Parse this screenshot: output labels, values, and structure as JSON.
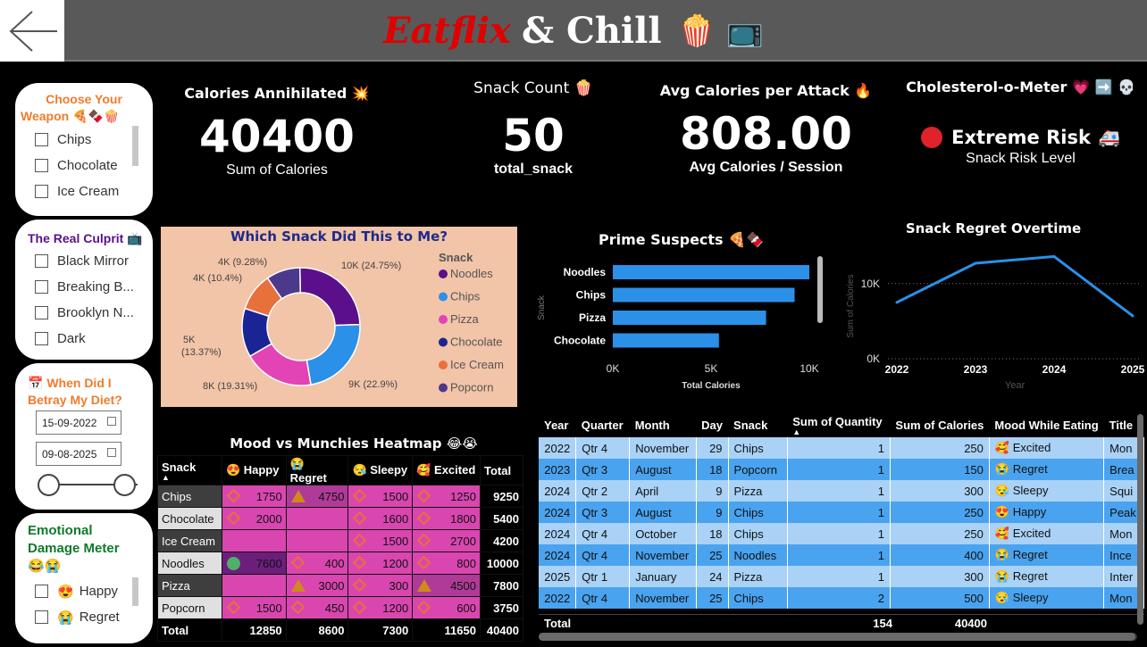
{
  "header": {
    "title_part1": "Eatflix",
    "title_part2": "& Chill",
    "title_emoji": "🍿 📺"
  },
  "slicers": {
    "weapon": {
      "title_line1": "Choose Your",
      "title_line2": "Weapon 🍕🍫🍿",
      "items": [
        "Chips",
        "Chocolate",
        "Ice Cream"
      ]
    },
    "culprit": {
      "title": "The Real Culprit 📺",
      "items": [
        "Black Mirror",
        "Breaking B...",
        "Brooklyn N...",
        "Dark"
      ]
    },
    "date": {
      "title_line1": "📅 When Did I",
      "title_line2": "Betray My Diet?",
      "start": "15-09-2022",
      "end": "09-08-2025",
      "range_fraction": [
        0,
        1
      ]
    },
    "damage": {
      "title_line1": "Emotional",
      "title_line2": "Damage Meter",
      "title_emoji": "😂😭",
      "items": [
        {
          "emoji": "😍",
          "label": "Happy"
        },
        {
          "emoji": "😭",
          "label": "Regret"
        }
      ]
    }
  },
  "kpis": {
    "calories": {
      "title": "Calories Annihilated 💥",
      "value": "40400",
      "sub": "Sum of Calories"
    },
    "count": {
      "title": "Snack Count 🍿",
      "value": "50",
      "sub": "total_snack"
    },
    "avg": {
      "title": "Avg Calories per Attack 🔥",
      "value": "808.00",
      "sub": "Avg Calories / Session"
    },
    "risk": {
      "title": "Cholesterol-o-Meter 💗 ➡️ 💀",
      "value": "Extreme Risk",
      "emoji": "🚑",
      "sub": "Snack Risk Level",
      "dot_color": "#e0222b"
    }
  },
  "donut": {
    "title": "Which Snack Did This to Me?",
    "legend_title": "Snack",
    "background": "#f2c4a8",
    "title_color": "#1f2a8a"
  },
  "bar": {
    "title": "Prime Suspects 🍕🍫",
    "ylabel": "Snack",
    "xlabel": "Total Calories"
  },
  "line": {
    "title": "Snack Regret Overtime",
    "xlabel": "Year",
    "ylabel": "Sum of Calories"
  },
  "heatmap": {
    "title": "Mood vs Munchies Heatmap 😂😭",
    "columns": [
      "Snack",
      "😍 Happy",
      "😭 Regret",
      "😪 Sleepy",
      "🥰 Excited",
      "Total"
    ],
    "rows": [
      {
        "snack": "Chips",
        "happy": "1750",
        "regret": "4750",
        "sleepy": "1500",
        "excited": "1250",
        "total": "9250",
        "icons": [
          "diamond",
          "triangle",
          "diamond",
          "diamond"
        ]
      },
      {
        "snack": "Chocolate",
        "happy": "2000",
        "regret": "",
        "sleepy": "1600",
        "excited": "1800",
        "total": "5400",
        "icons": [
          "diamond",
          "",
          "diamond",
          "diamond"
        ]
      },
      {
        "snack": "Ice Cream",
        "happy": "",
        "regret": "",
        "sleepy": "1500",
        "excited": "2700",
        "total": "4200",
        "icons": [
          "",
          "",
          "diamond",
          "diamond"
        ]
      },
      {
        "snack": "Noodles",
        "happy": "7600",
        "regret": "400",
        "sleepy": "1200",
        "excited": "800",
        "total": "10000",
        "icons": [
          "circle",
          "diamond",
          "diamond",
          "diamond"
        ]
      },
      {
        "snack": "Pizza",
        "happy": "",
        "regret": "3000",
        "sleepy": "300",
        "excited": "4500",
        "total": "7800",
        "icons": [
          "",
          "triangle",
          "diamond",
          "triangle"
        ]
      },
      {
        "snack": "Popcorn",
        "happy": "1500",
        "regret": "450",
        "sleepy": "1200",
        "excited": "600",
        "total": "3750",
        "icons": [
          "diamond",
          "diamond",
          "diamond",
          "diamond"
        ]
      }
    ],
    "total_row": {
      "label": "Total",
      "happy": "12850",
      "regret": "8600",
      "sleepy": "7300",
      "excited": "11650",
      "total": "40400"
    }
  },
  "detail_table": {
    "columns": [
      "Year",
      "Quarter",
      "Month",
      "Day",
      "Snack",
      "Sum of Quantity",
      "Sum of Calories",
      "Mood While Eating",
      "Title"
    ],
    "rows": [
      [
        "2022",
        "Qtr 4",
        "November",
        "29",
        "Chips",
        "1",
        "250",
        "🥰 Excited",
        "Mon"
      ],
      [
        "2023",
        "Qtr 3",
        "August",
        "18",
        "Popcorn",
        "1",
        "150",
        "😭 Regret",
        "Brea"
      ],
      [
        "2024",
        "Qtr 2",
        "April",
        "9",
        "Pizza",
        "1",
        "300",
        "😪 Sleepy",
        "Squi"
      ],
      [
        "2024",
        "Qtr 3",
        "August",
        "9",
        "Chips",
        "1",
        "250",
        "😍 Happy",
        "Peak"
      ],
      [
        "2024",
        "Qtr 4",
        "October",
        "18",
        "Chips",
        "1",
        "250",
        "🥰 Excited",
        "Mon"
      ],
      [
        "2024",
        "Qtr 4",
        "November",
        "25",
        "Noodles",
        "1",
        "400",
        "😭 Regret",
        "Ince"
      ],
      [
        "2025",
        "Qtr 1",
        "January",
        "24",
        "Pizza",
        "1",
        "300",
        "😭 Regret",
        "Inter"
      ],
      [
        "2022",
        "Qtr 4",
        "November",
        "25",
        "Chips",
        "2",
        "500",
        "😪 Sleepy",
        "Mon"
      ]
    ],
    "total_label": "Total",
    "total_quantity": "154",
    "total_calories": "40400"
  },
  "chart_data": [
    {
      "type": "pie",
      "title": "Which Snack Did This to Me?",
      "legend_title": "Snack",
      "categories": [
        "Noodles",
        "Chips",
        "Pizza",
        "Chocolate",
        "Ice Cream",
        "Popcorn"
      ],
      "values": [
        10000,
        9250,
        7800,
        5400,
        4200,
        3750
      ],
      "labels": [
        "10K (24.75%)",
        "9K (22.9%)",
        "8K (19.31%)",
        "5K (13.37%)",
        "4K (10.4%)",
        "4K (9.28%)"
      ],
      "colors": [
        "#5b0f8a",
        "#2b90e8",
        "#e244b6",
        "#1a2494",
        "#e8703a",
        "#4b3a8c"
      ],
      "hole": true
    },
    {
      "type": "bar",
      "orientation": "horizontal",
      "title": "Prime Suspects 🍕🍫",
      "categories": [
        "Noodles",
        "Chips",
        "Pizza",
        "Chocolate"
      ],
      "values": [
        10000,
        9250,
        7800,
        5400
      ],
      "xlabel": "Total Calories",
      "ylabel": "Snack",
      "xlim": [
        0,
        10000
      ],
      "xticks": [
        "0K",
        "5K",
        "10K"
      ],
      "color": "#2b90e8"
    },
    {
      "type": "line",
      "title": "Snack Regret Overtime",
      "x": [
        2022,
        2023,
        2024,
        2025
      ],
      "values": [
        7500,
        12700,
        13600,
        5700
      ],
      "xlabel": "Year",
      "ylabel": "Sum of Calories",
      "ylim": [
        0,
        16500
      ],
      "yticks": [
        "0K",
        "10K"
      ],
      "grid": true,
      "color": "#2b90e8"
    }
  ]
}
